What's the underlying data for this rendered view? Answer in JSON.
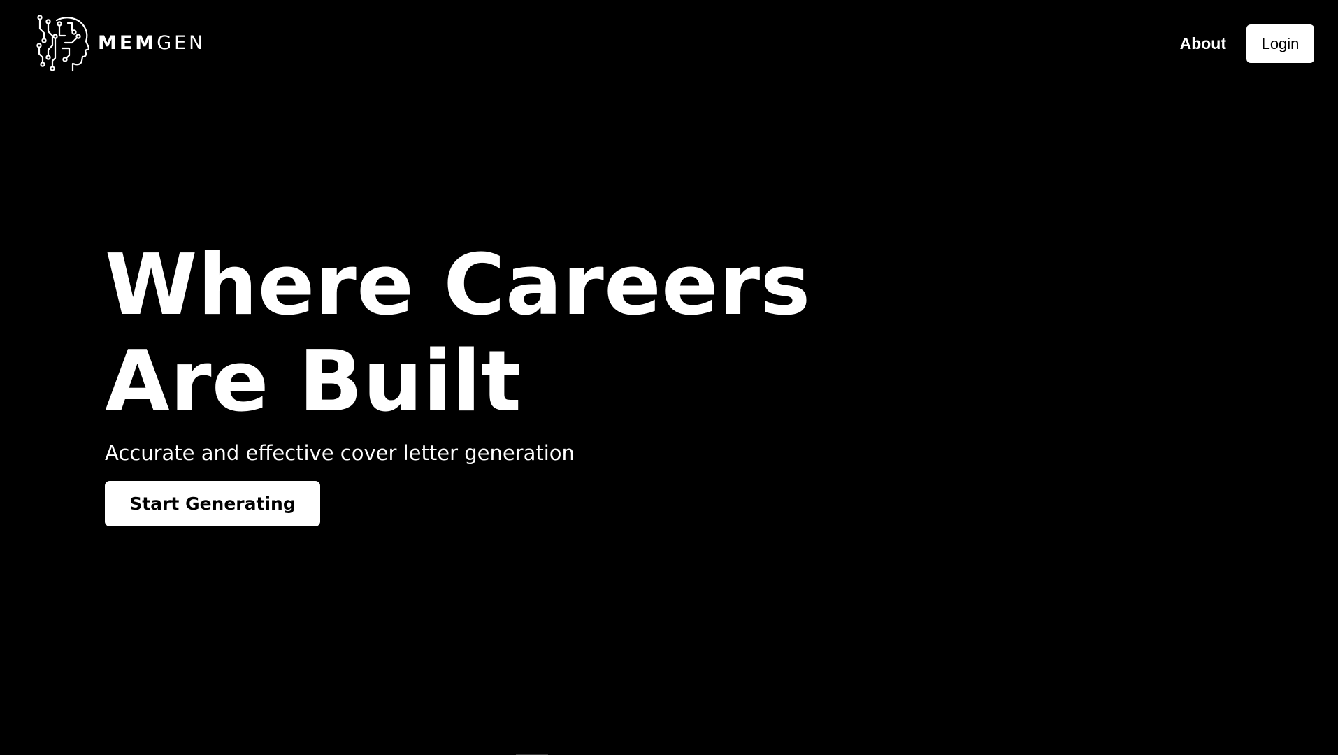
{
  "colors": {
    "background": "#000000",
    "foreground": "#ffffff",
    "button_text": "#000000"
  },
  "header": {
    "logo": {
      "icon": "circuit-head-icon",
      "text_strong": "MEM",
      "text_light": "GEN"
    },
    "nav": {
      "about_label": "About",
      "login_label": "Login"
    }
  },
  "hero": {
    "title_line_1": "Where Careers",
    "title_line_2": "Are Built",
    "subtitle": "Accurate and effective cover letter generation",
    "cta_label": "Start Generating"
  }
}
